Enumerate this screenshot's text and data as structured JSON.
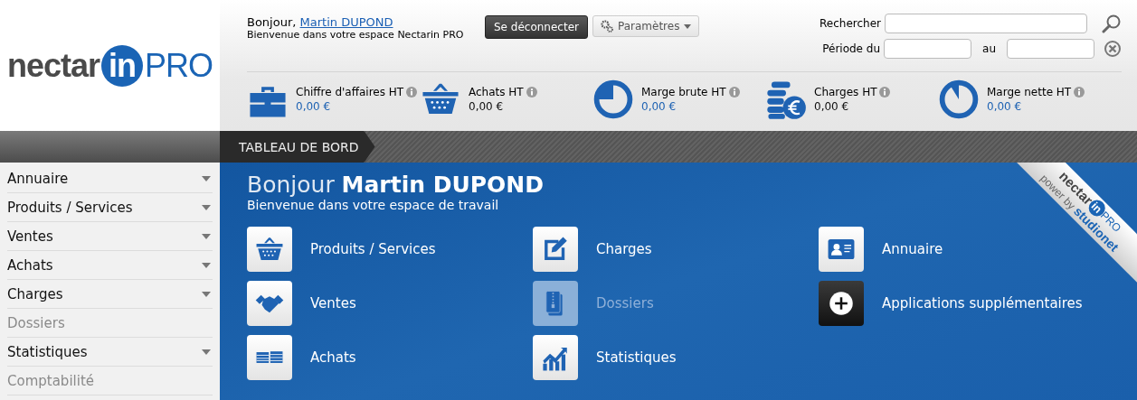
{
  "logo": {
    "word": "nectar",
    "badge": "in",
    "suffix": "PRO"
  },
  "header": {
    "greeting": "Bonjour,",
    "user_name": "Martin DUPOND",
    "welcome": "Bienvenue dans votre espace Nectarin PRO",
    "logout_button": "Se déconnecter",
    "settings_button": "Paramètres",
    "search_label": "Rechercher",
    "period_from_label": "Période du",
    "period_to_label": "au"
  },
  "kpis": [
    {
      "kind": "briefcase",
      "label": "Chiffre d'affaires HT",
      "value": "0,00 €",
      "color": "#1f63b3"
    },
    {
      "kind": "basket",
      "label": "Achats HT",
      "value": "0,00 €",
      "color": "#111111"
    },
    {
      "kind": "pie-quarter",
      "label": "Marge brute HT",
      "value": "0,00 €",
      "color": "#1f63b3"
    },
    {
      "kind": "coins",
      "label": "Charges HT",
      "value": "0,00 €",
      "color": "#111111"
    },
    {
      "kind": "pie-slice",
      "label": "Marge nette HT",
      "value": "0,00 €",
      "color": "#1f63b3"
    }
  ],
  "breadcrumb": "TABLEAU DE BORD",
  "sidebar": {
    "items": [
      {
        "label": "Annuaire",
        "disabled": false
      },
      {
        "label": "Produits / Services",
        "disabled": false
      },
      {
        "label": "Ventes",
        "disabled": false
      },
      {
        "label": "Achats",
        "disabled": false
      },
      {
        "label": "Charges",
        "disabled": false
      },
      {
        "label": "Dossiers",
        "disabled": true
      },
      {
        "label": "Statistiques",
        "disabled": false
      },
      {
        "label": "Comptabilité",
        "disabled": true
      }
    ]
  },
  "main": {
    "greeting": "Bonjour",
    "user_name": "Martin DUPOND",
    "subtitle": "Bienvenue dans votre espace de travail"
  },
  "tiles": [
    {
      "kind": "basket",
      "label": "Produits / Services",
      "disabled": false
    },
    {
      "kind": "edit",
      "label": "Charges",
      "disabled": false
    },
    {
      "kind": "contact",
      "label": "Annuaire",
      "disabled": false
    },
    {
      "kind": "handshake",
      "label": "Ventes",
      "disabled": false
    },
    {
      "kind": "archive",
      "label": "Dossiers",
      "disabled": true
    },
    {
      "kind": "add",
      "label": "Applications supplémentaires",
      "disabled": false
    },
    {
      "kind": "money",
      "label": "Achats",
      "disabled": false
    },
    {
      "kind": "chart",
      "label": "Statistiques",
      "disabled": false
    }
  ],
  "ribbon": {
    "brand": "nectar",
    "badge": "in",
    "suffix": "PRO",
    "tagline": "power by",
    "company": "studionet"
  }
}
